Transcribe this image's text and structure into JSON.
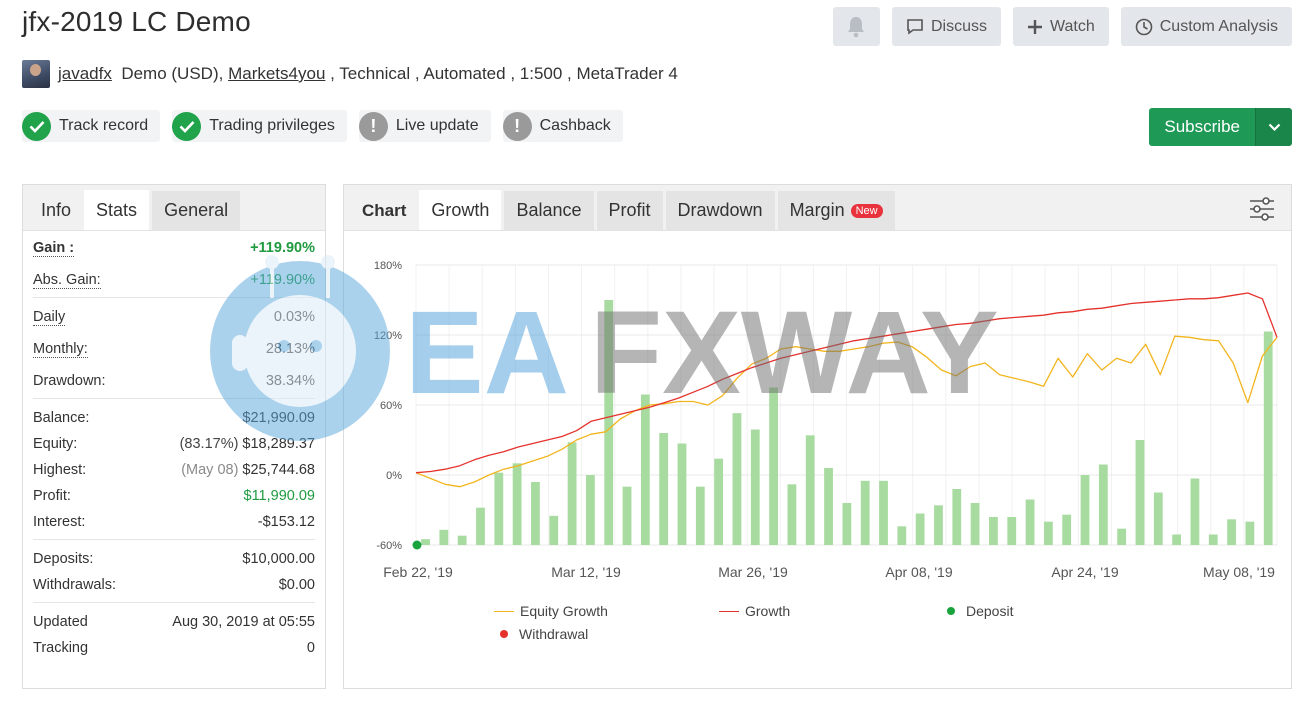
{
  "header": {
    "title": "jfx-2019 LC Demo",
    "actions": {
      "discuss": "Discuss",
      "watch": "Watch",
      "custom_analysis": "Custom Analysis"
    }
  },
  "meta": {
    "user": "javadfx",
    "account_type": "Demo (USD),",
    "broker": "Markets4you",
    "details": " , Technical , Automated , 1:500 , MetaTrader 4"
  },
  "badges": {
    "track_record": "Track record",
    "trading_privileges": "Trading privileges",
    "live_update": "Live update",
    "cashback": "Cashback"
  },
  "subscribe": {
    "label": "Subscribe"
  },
  "left_tabs": {
    "info": "Info",
    "stats": "Stats",
    "general": "General"
  },
  "stats": {
    "gain_label": "Gain :",
    "gain_value": "+119.90%",
    "abs_gain_label": "Abs. Gain:",
    "abs_gain_value": "+119.90%",
    "daily_label": "Daily",
    "daily_value": "0.03%",
    "monthly_label": "Monthly:",
    "monthly_value": "28.13%",
    "drawdown_label": "Drawdown:",
    "drawdown_value": "38.34%",
    "balance_label": "Balance:",
    "balance_value": "$21,990.09",
    "equity_label": "Equity:",
    "equity_pct": "(83.17%)",
    "equity_value": "$18,289.37",
    "highest_label": "Highest:",
    "highest_date": "(May 08)",
    "highest_value": "$25,744.68",
    "profit_label": "Profit:",
    "profit_value": "$11,990.09",
    "interest_label": "Interest:",
    "interest_value": "-$153.12",
    "deposits_label": "Deposits:",
    "deposits_value": "$10,000.00",
    "withdrawals_label": "Withdrawals:",
    "withdrawals_value": "$0.00",
    "updated_label": "Updated",
    "updated_value": "Aug 30, 2019 at 05:55",
    "tracking_label": "Tracking",
    "tracking_value": "0"
  },
  "chart_tabs": {
    "chart": "Chart",
    "growth": "Growth",
    "balance": "Balance",
    "profit": "Profit",
    "drawdown": "Drawdown",
    "margin": "Margin",
    "new": "New"
  },
  "watermark": {
    "text_blue": "EA",
    "text_gray": "FXWAY"
  },
  "colors": {
    "equity_line": "#f2b51e",
    "growth_line": "#e5312c",
    "bars": "#a8dba0",
    "deposit": "#19a33c",
    "withdrawal": "#e5312c",
    "accent_green": "#1f9a56"
  },
  "chart_data": {
    "type": "line",
    "y_ticks": [
      "180%",
      "120%",
      "60%",
      "0%",
      "-60%"
    ],
    "ylim": [
      -60,
      180
    ],
    "x_ticks": [
      "Feb 22, '19",
      "Mar 12, '19",
      "Mar 26, '19",
      "Apr 08, '19",
      "Apr 24, '19",
      "May 08, '19"
    ],
    "legend": [
      "Equity Growth",
      "Growth",
      "Deposit",
      "Withdrawal"
    ],
    "series": [
      {
        "name": "Growth",
        "values": [
          2,
          3,
          5,
          8,
          13,
          17,
          20,
          24,
          27,
          30,
          33,
          38,
          46,
          49,
          52,
          55,
          58,
          62,
          66,
          71,
          76,
          82,
          87,
          92,
          96,
          100,
          103,
          106,
          109,
          112,
          115,
          117,
          119,
          121,
          123,
          125,
          127,
          129,
          130,
          132,
          134,
          135,
          136,
          137,
          139,
          140,
          142,
          143,
          145,
          147,
          148,
          149,
          150,
          151,
          151,
          152,
          154,
          156,
          151,
          118
        ]
      },
      {
        "name": "Equity Growth",
        "values": [
          2,
          -3,
          -8,
          -10,
          -6,
          0,
          5,
          8,
          12,
          16,
          22,
          30,
          35,
          37,
          48,
          55,
          60,
          61,
          63,
          63,
          60,
          68,
          83,
          95,
          100,
          108,
          110,
          108,
          106,
          106,
          108,
          110,
          113,
          114,
          110,
          101,
          90,
          85,
          93,
          96,
          86,
          83,
          80,
          76,
          100,
          84,
          104,
          90,
          100,
          96,
          112,
          86,
          119,
          118,
          116,
          115,
          96,
          62,
          102,
          118
        ]
      },
      {
        "name": "Daily bars",
        "values": [
          -55,
          -47,
          -52,
          -28,
          2,
          10,
          -6,
          -35,
          28,
          0,
          150,
          -10,
          69,
          36,
          27,
          -10,
          14,
          53,
          39,
          75,
          -8,
          34,
          6,
          -24,
          -5,
          -5,
          -44,
          -33,
          -26,
          -12,
          -24,
          -36,
          -36,
          -21,
          -40,
          -34,
          0,
          9,
          -46,
          30,
          -15,
          -51,
          -3,
          -51,
          -38,
          -40,
          123
        ],
        "valuesTop": [
          -55,
          -47,
          -52,
          -28,
          2,
          10,
          -6,
          -35,
          28,
          0,
          150,
          -10,
          69,
          36,
          27,
          -10,
          14,
          53,
          39,
          75,
          -8,
          34,
          6,
          -24,
          -5,
          -5,
          -44,
          -33,
          -26,
          -12,
          -24,
          -36,
          -36,
          -21,
          -40,
          -34,
          0,
          9,
          -46,
          30,
          -15,
          -51,
          -3,
          -51,
          -38,
          -40,
          123
        ]
      }
    ],
    "deposit_points": [
      {
        "x": "Feb 22, '19",
        "y": -60
      }
    ]
  }
}
